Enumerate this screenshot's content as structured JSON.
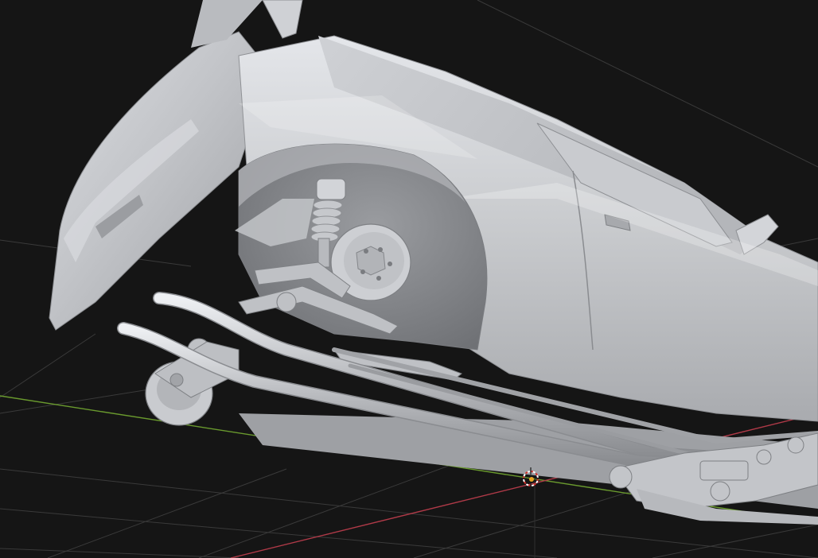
{
  "viewport": {
    "background_color": "#151515",
    "grid_color": "#3a3a3a",
    "x_axis_color": "#b03a48",
    "y_axis_color": "#6a9a2e",
    "z_axis_color": "#2e2e2e",
    "model_color": "#c4c6ca",
    "model_shadow_color": "#8c8e92",
    "model_highlight_color": "#eef0f3",
    "cursor_color_primary": "#d0302a",
    "cursor_color_secondary": "#ffffff",
    "origin_color": "#e8a321"
  },
  "objects": [
    {
      "name": "car-body",
      "icon": "car-mesh-icon"
    },
    {
      "name": "3d-cursor",
      "icon": "crosshair-icon"
    }
  ]
}
